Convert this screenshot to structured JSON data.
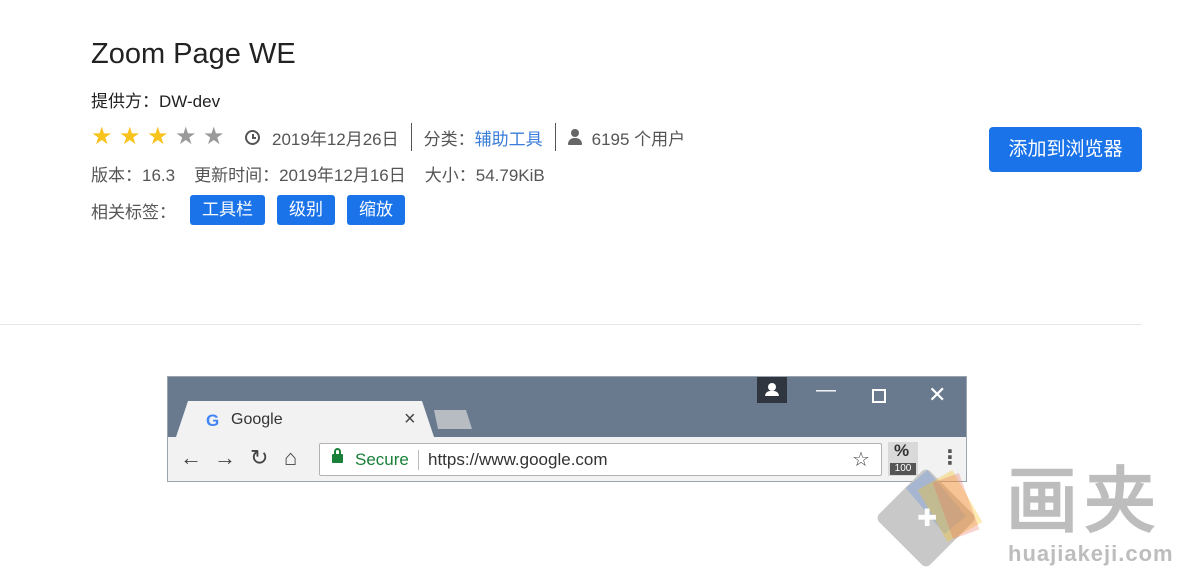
{
  "extension": {
    "title": "Zoom Page WE",
    "provider": "提供方：DW-dev",
    "rating": {
      "value": 3,
      "max": 5
    },
    "date": "2019年12月26日",
    "category_label": "分类：",
    "category": "辅助工具",
    "users": "6195 个用户",
    "version": "版本：16.3",
    "updated": "更新时间：2019年12月16日",
    "size": "大小：54.79KiB",
    "tags_label": "相关标签：",
    "tags": [
      "工具栏",
      "级别",
      "缩放"
    ],
    "add_button": "添加到浏览器"
  },
  "colors": {
    "accent": "#1a73e8",
    "star_on": "#f7c31c",
    "star_off": "#9a9a9a",
    "link": "#3b7dd8"
  },
  "screenshot": {
    "tab_title": "Google",
    "tab_favicon": "G",
    "secure_label": "Secure",
    "url": "https://www.google.com",
    "ext_symbol": "%",
    "ext_badge": "100"
  },
  "watermark": {
    "text": "画夹",
    "url": "huajiakeji.com"
  }
}
